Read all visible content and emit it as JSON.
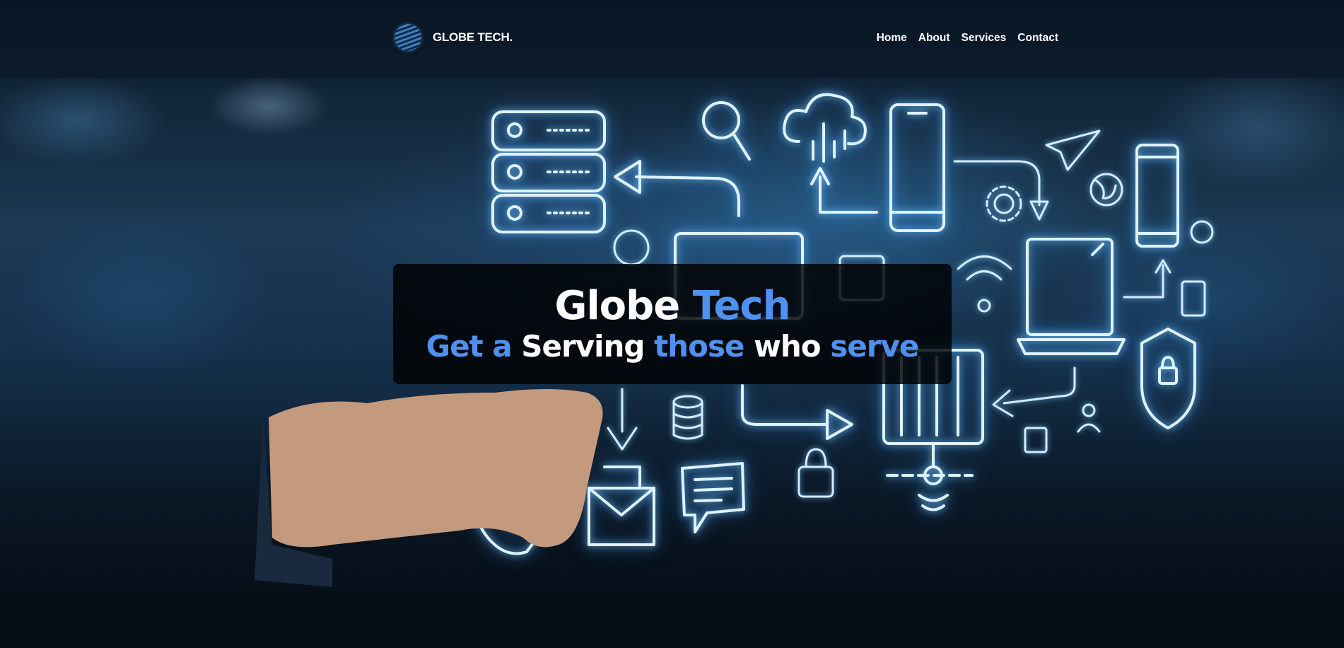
{
  "colors": {
    "accent": "#4f91f0",
    "text": "#ffffff",
    "card": "rgba(0,0,0,0.82)"
  },
  "brand": {
    "name": "GLOBE TECH.",
    "logo_icon": "globe-icon"
  },
  "nav": {
    "items": [
      "Home",
      "About",
      "Services",
      "Contact"
    ]
  },
  "hero": {
    "title": {
      "part1": "Globe",
      "part2": "Tech"
    },
    "subtitle": {
      "p1": "Get a",
      "p2": "Serving",
      "p3": "those",
      "p4": "who",
      "p5": "serve"
    }
  }
}
